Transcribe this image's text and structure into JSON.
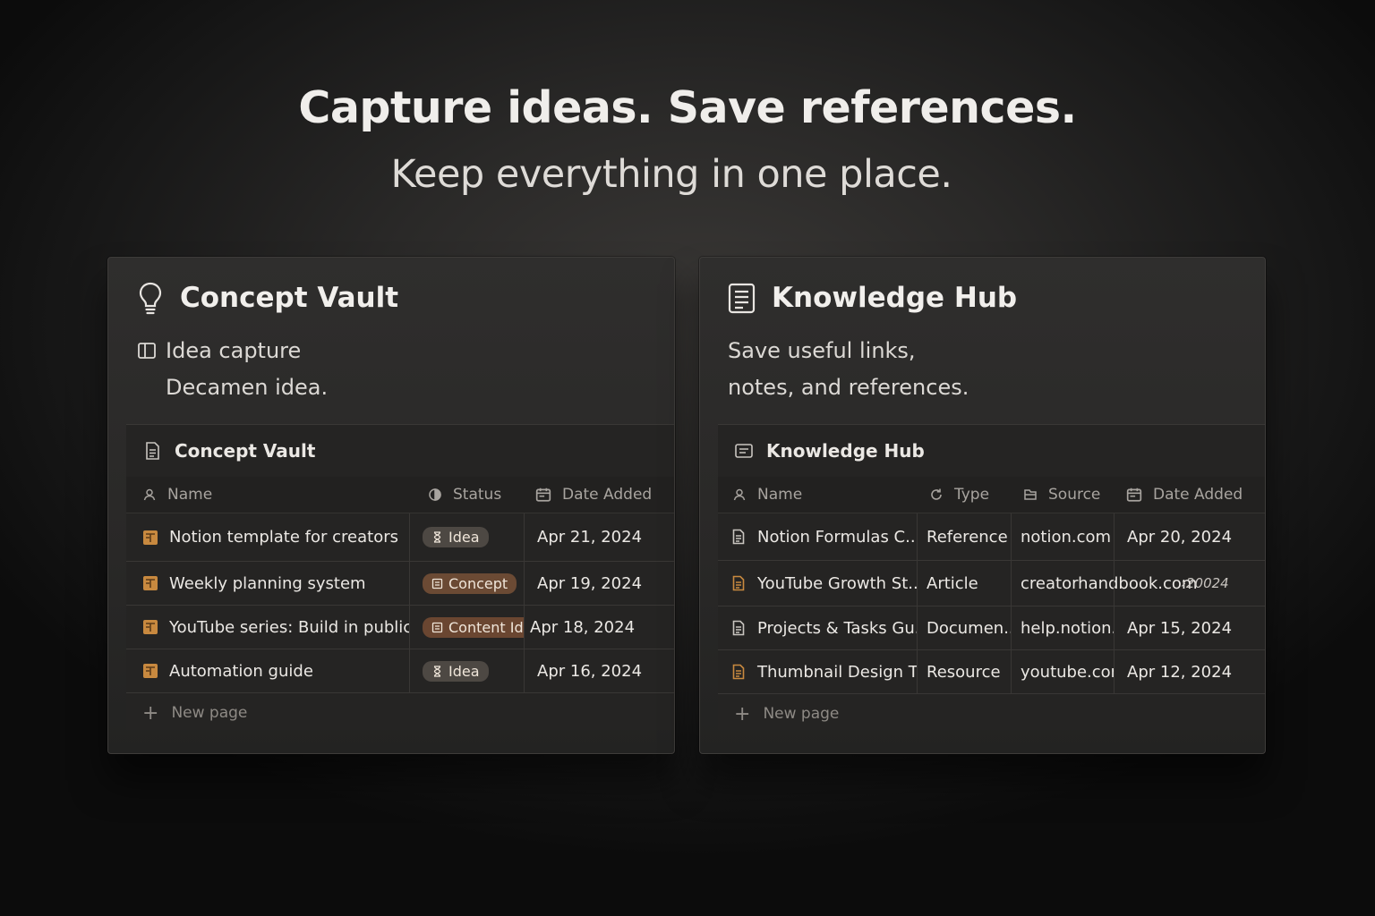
{
  "hero": {
    "title": "Capture ideas. Save references.",
    "subtitle": "Keep everything in one place."
  },
  "concept_vault": {
    "title": "Concept Vault",
    "icon": "lightbulb-icon",
    "subtitle_line1": "Idea capture",
    "subtitle_line2": "Decamen idea.",
    "db_title": "Concept Vault",
    "columns": [
      "Name",
      "Status",
      "Date Added"
    ],
    "rows": [
      {
        "name": "Notion template for creators",
        "status": "Idea",
        "status_kind": "idea",
        "date": "Apr 21, 2024"
      },
      {
        "name": "Weekly planning system",
        "status": "Concept",
        "status_kind": "concept",
        "date": "Apr 19, 2024"
      },
      {
        "name": "YouTube series: Build in public",
        "status": "Content Idea",
        "status_kind": "content",
        "date": "Apr 18, 2024"
      },
      {
        "name": "Automation guide",
        "status": "Idea",
        "status_kind": "idea",
        "date": "Apr 16, 2024"
      }
    ],
    "new_page": "New page"
  },
  "knowledge_hub": {
    "title": "Knowledge Hub",
    "icon": "document-icon",
    "subtitle_line1": "Save useful links,",
    "subtitle_line2": "notes, and references.",
    "db_title": "Knowledge Hub",
    "columns": [
      "Name",
      "Type",
      "Source",
      "Date Added"
    ],
    "rows": [
      {
        "name": "Notion Formulas C...",
        "type": "Reference",
        "source": "notion.com",
        "date": "Apr 20, 2024"
      },
      {
        "name": "YouTube Growth St...",
        "type": "Article",
        "source": "creatorhandbook.com",
        "date": "›20024"
      },
      {
        "name": "Projects & Tasks Gu...",
        "type": "Documen...",
        "source": "help.notion.com",
        "date": "Apr 15, 2024"
      },
      {
        "name": "Thumbnail Design Tips",
        "type": "Resource",
        "source": "youtube.com",
        "date": "Apr 12, 2024"
      }
    ],
    "new_page": "New page"
  },
  "colors": {
    "accent_orange": "#c8893f",
    "idea_pill": "#4d4843",
    "concept_pill": "#6b4a34"
  }
}
